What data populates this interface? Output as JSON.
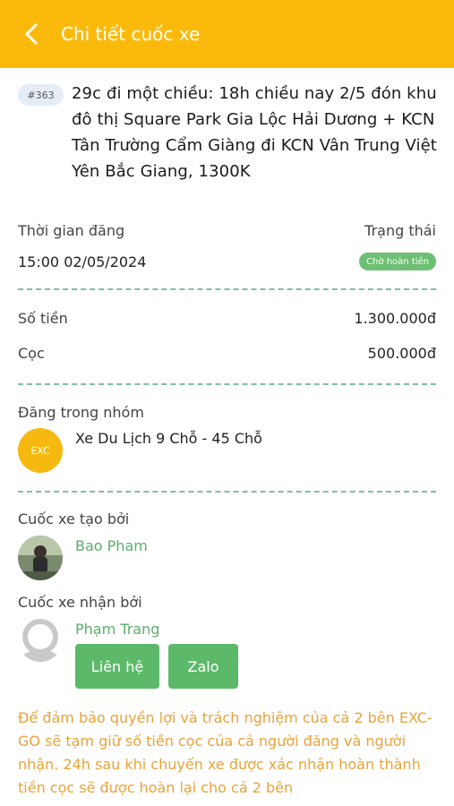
{
  "header": {
    "title": "Chi tiết cuốc xe"
  },
  "trip": {
    "id_badge": "#363",
    "title": "29c đi một chiều: 18h chiều nay 2/5 đón khu đô thị Square Park Gia Lộc Hải Dương + KCN Tân Trường Cẩm Giàng đi KCN Vân Trung Việt Yên Bắc Giang, 1300K"
  },
  "info": {
    "posted_time_label": "Thời gian đăng",
    "posted_time_value": "15:00 02/05/2024",
    "status_label": "Trạng thái",
    "status_value": "Chờ hoàn tiền",
    "amount_label": "Số tiền",
    "amount_value": "1.300.000đ",
    "deposit_label": "Cọc",
    "deposit_value": "500.000đ"
  },
  "group": {
    "label": "Đăng trong nhóm",
    "logo_text": "EXC",
    "name": "Xe Du Lịch 9 Chỗ - 45 Chỗ"
  },
  "creator": {
    "label": "Cuốc xe tạo bởi",
    "name": "Bao Pham"
  },
  "receiver": {
    "label": "Cuốc xe nhận bởi",
    "name": "Phạm Trang",
    "contact_button": "Liên hệ",
    "zalo_button": "Zalo"
  },
  "notice": "Để đảm bảo quyền lợi và trách nghiệm của cả 2 bên EXC-GO sẽ tạm giữ số tiền cọc của cả người đăng và người nhận. 24h sau khi chuyến xe được xác nhận hoàn thành tiền cọc sẽ được hoàn lại cho cả 2 bên",
  "colors": {
    "header": "#FBBA0B",
    "accent_green": "#5CB96A",
    "notice": "#E8A33A"
  }
}
